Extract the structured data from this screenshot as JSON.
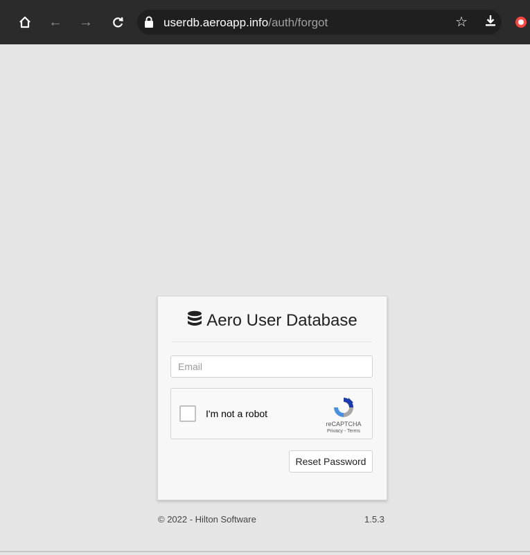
{
  "browser": {
    "url_host": "userdb.aeroapp.info",
    "url_path": "/auth/forgot",
    "icons": [
      "home-icon",
      "back-icon",
      "forward-icon",
      "reload-icon",
      "lock-icon",
      "star-icon",
      "download-icon",
      "extension-icon"
    ]
  },
  "card": {
    "title": "Aero User Database",
    "email_placeholder": "Email",
    "email_value": "",
    "captcha_label": "I'm not a robot",
    "captcha_brand": "reCAPTCHA",
    "captcha_links": "Privacy - Terms",
    "reset_label": "Reset Password"
  },
  "footer": {
    "copyright": "© 2022 - Hilton Software",
    "version": "1.5.3"
  },
  "colors": {
    "background": "#e5e5e5",
    "browser_bar": "#2b2b2b",
    "card": "#f7f7f7"
  }
}
